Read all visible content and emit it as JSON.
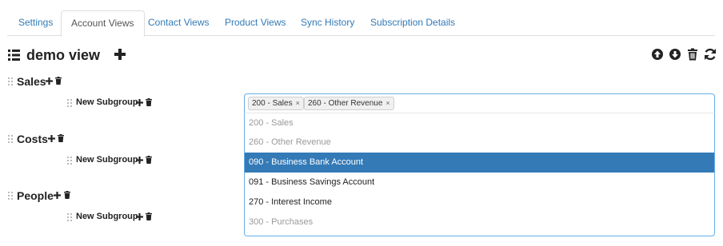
{
  "tabs": [
    {
      "label": "Settings"
    },
    {
      "label": "Account Views"
    },
    {
      "label": "Contact Views"
    },
    {
      "label": "Product Views"
    },
    {
      "label": "Sync History"
    },
    {
      "label": "Subscription Details"
    }
  ],
  "view": {
    "title": "demo view"
  },
  "toolbar": {
    "icons": [
      "arrow-circle-up-icon",
      "arrow-circle-down-icon",
      "trash-icon",
      "refresh-icon"
    ]
  },
  "groups": [
    {
      "label": "Sales",
      "subgroup_label": "New Subgroup"
    },
    {
      "label": "Costs",
      "subgroup_label": "New Subgroup"
    },
    {
      "label": "People",
      "subgroup_label": "New Subgroup"
    }
  ],
  "select": {
    "chips": [
      "200 - Sales",
      "260 - Other Revenue"
    ],
    "chip_remove": "×",
    "options": [
      {
        "label": "200 - Sales",
        "state": "disabled"
      },
      {
        "label": "260 - Other Revenue",
        "state": "disabled"
      },
      {
        "label": "090 - Business Bank Account",
        "state": "highlighted"
      },
      {
        "label": "091 - Business Savings Account",
        "state": "normal"
      },
      {
        "label": "270 - Interest Income",
        "state": "normal"
      },
      {
        "label": "300 - Purchases",
        "state": "disabled"
      }
    ]
  },
  "colors": {
    "link": "#337ab7",
    "highlight": "#337ab7",
    "focus_border": "#66afe9"
  }
}
